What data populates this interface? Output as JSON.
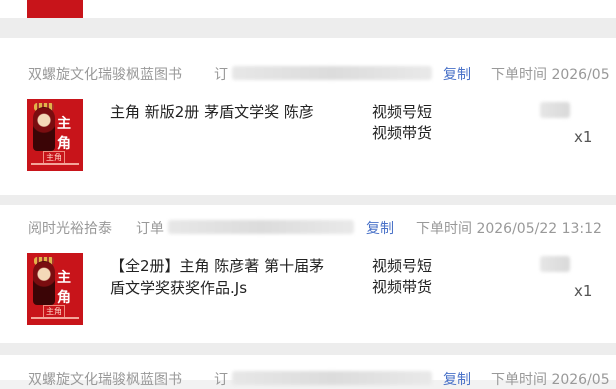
{
  "orders": [
    {
      "store": "",
      "order_label": "",
      "copy_label": "",
      "time_label": "",
      "product_title": "",
      "thumb_title": "",
      "channel_lines": [
        "",
        ""
      ],
      "qty": ""
    },
    {
      "store": "双螺旋文化瑞骏枫蓝图书",
      "order_label": "订",
      "copy_label": "复制",
      "time_label": "下单时间 2026/05",
      "product_title": "主角 新版2册 茅盾文学奖 陈彦",
      "thumb_title": "主角",
      "channel_lines": [
        "视频号短",
        "视频带货"
      ],
      "qty": "x1"
    },
    {
      "store": "阅时光裕拾泰",
      "order_label": "订单",
      "copy_label": "复制",
      "time_label": "下单时间 2026/05/22 13:12",
      "product_title": "【全2册】主角 陈彦著 第十届茅盾文学奖获奖作品.Js",
      "thumb_title": "主角",
      "channel_lines": [
        "视频号短",
        "视频带货"
      ],
      "qty": "x1"
    },
    {
      "store": "双螺旋文化瑞骏枫蓝图书",
      "order_label": "订",
      "copy_label": "复制",
      "time_label": "下单时间 2026/05",
      "product_title": "",
      "thumb_title": "",
      "channel_lines": [
        "",
        ""
      ],
      "qty": ""
    }
  ],
  "colors": {
    "link": "#4a72c8",
    "muted": "#999999",
    "thumb_red": "#c8141a"
  }
}
